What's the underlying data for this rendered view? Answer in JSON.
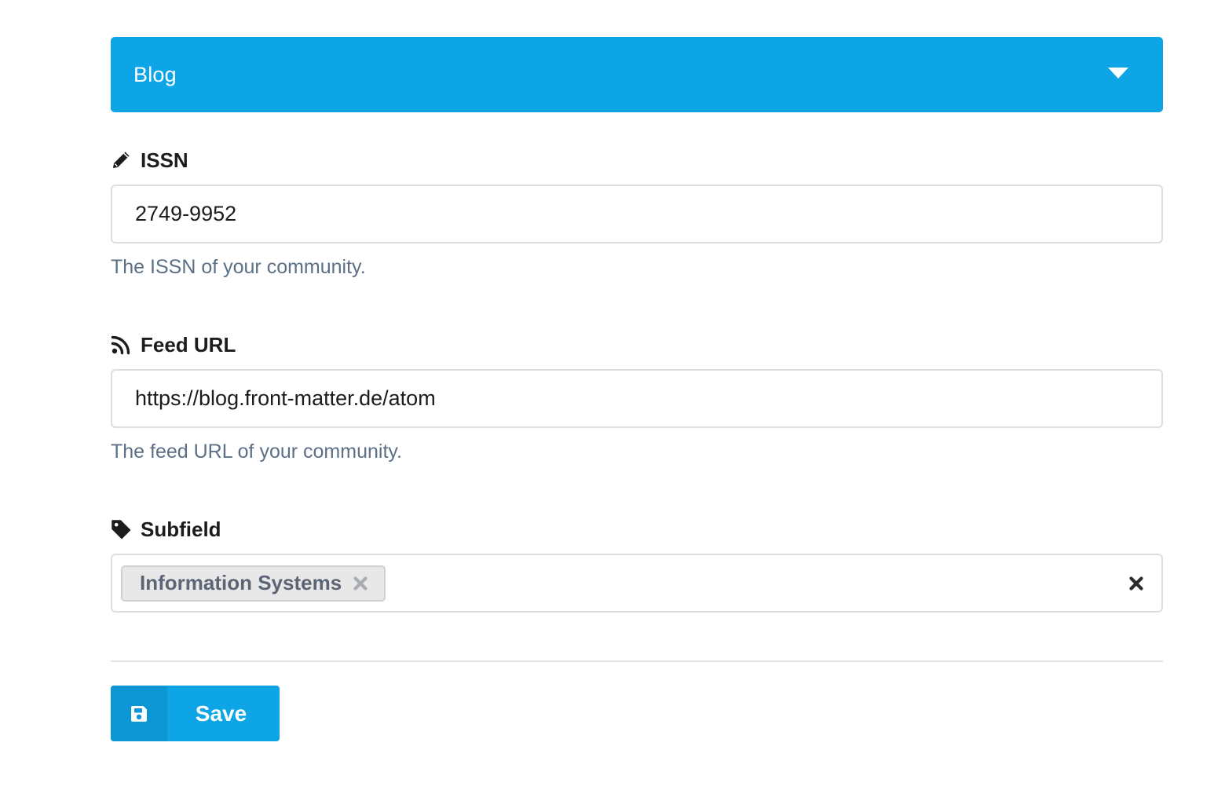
{
  "accordion": {
    "title": "Blog",
    "toggle_icon": "caret-down-icon"
  },
  "fields": {
    "issn": {
      "label": "ISSN",
      "icon": "pencil-icon",
      "value": "2749-9952",
      "help": "The ISSN of your community."
    },
    "feed_url": {
      "label": "Feed URL",
      "icon": "rss-icon",
      "value": "https://blog.front-matter.de/atom",
      "help": "The feed URL of your community."
    },
    "subfield": {
      "label": "Subfield",
      "icon": "tag-icon",
      "selected": [
        "Information Systems"
      ],
      "remove_icon": "close-icon",
      "clear_icon": "close-icon"
    }
  },
  "actions": {
    "save_label": "Save",
    "save_icon": "floppy-disk-icon"
  },
  "colors": {
    "primary": "#0ea5e6",
    "primary_dark": "#0c97d4",
    "help_text": "#5b6f86",
    "border": "#dcdee0",
    "tag_background": "#e8e8e8"
  }
}
